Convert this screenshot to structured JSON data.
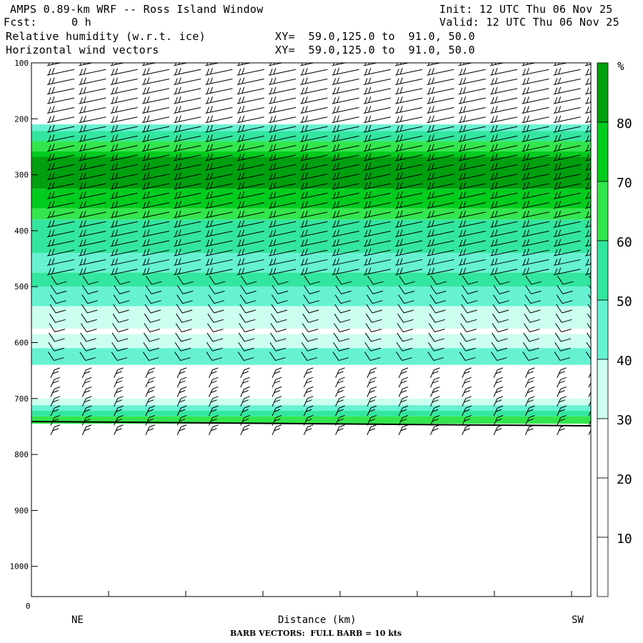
{
  "header": {
    "title": "AMPS 0.89-km WRF -- Ross Island Window",
    "init": "Init: 12 UTC Thu 06 Nov 25",
    "fcst_label": "Fcst:",
    "fcst_value": "0 h",
    "valid": "Valid: 12 UTC Thu 06 Nov 25",
    "field1": "Relative humidity (w.r.t. ice)",
    "field2": "Horizontal wind vectors",
    "xy1": "XY=  59.0,125.0 to  91.0, 50.0",
    "xy2": "XY=  59.0,125.0 to  91.0, 50.0"
  },
  "footer": {
    "x_axis_title": "Distance (km)",
    "left_end": "NE",
    "right_end": "SW",
    "origin_label": "0",
    "barb_note": "BARB VECTORS:  FULL BARB = 10 kts"
  },
  "chart_data": {
    "type": "heatmap",
    "title": "Relative humidity (w.r.t. ice)",
    "xlabel": "Distance (km)",
    "ylabel": "",
    "y_ticks": [
      "100",
      "200",
      "300",
      "400",
      "500",
      "600",
      "700",
      "800",
      "900",
      "1000"
    ],
    "ylim": [
      100,
      1050
    ],
    "y_axis": "pressure-like, increasing downward",
    "terrain_level": 745,
    "colorbar": {
      "unit": "%",
      "levels": [
        10,
        20,
        30,
        40,
        50,
        60,
        70,
        80
      ],
      "labels": [
        "10",
        "20",
        "30",
        "40",
        "50",
        "60",
        "70",
        "80"
      ],
      "colors": [
        "#ffffff",
        "#ffffff",
        "#ffffff",
        "#ccfff0",
        "#66f2d2",
        "#33e69f",
        "#33e64d",
        "#00cc1e",
        "#009f0f"
      ],
      "bins": [
        "0-10",
        "10-20",
        "20-30",
        "30-40",
        "40-50",
        "50-60",
        "60-70",
        "70-80",
        "80-100"
      ]
    },
    "rh_profile": [
      {
        "p_top": 100,
        "p_bottom": 210,
        "rh": 25
      },
      {
        "p_top": 210,
        "p_bottom": 222,
        "rh": 42
      },
      {
        "p_top": 222,
        "p_bottom": 240,
        "rh": 55
      },
      {
        "p_top": 240,
        "p_bottom": 258,
        "rh": 65
      },
      {
        "p_top": 258,
        "p_bottom": 268,
        "rh": 75
      },
      {
        "p_top": 268,
        "p_bottom": 325,
        "rh": 85
      },
      {
        "p_top": 325,
        "p_bottom": 360,
        "rh": 75
      },
      {
        "p_top": 360,
        "p_bottom": 380,
        "rh": 65
      },
      {
        "p_top": 380,
        "p_bottom": 440,
        "rh": 55
      },
      {
        "p_top": 440,
        "p_bottom": 475,
        "rh": 45
      },
      {
        "p_top": 475,
        "p_bottom": 500,
        "rh": 55
      },
      {
        "p_top": 500,
        "p_bottom": 535,
        "rh": 45
      },
      {
        "p_top": 535,
        "p_bottom": 575,
        "rh": 35
      },
      {
        "p_top": 575,
        "p_bottom": 585,
        "rh": 25
      },
      {
        "p_top": 585,
        "p_bottom": 610,
        "rh": 35
      },
      {
        "p_top": 610,
        "p_bottom": 640,
        "rh": 45
      },
      {
        "p_top": 640,
        "p_bottom": 700,
        "rh": 25
      },
      {
        "p_top": 700,
        "p_bottom": 712,
        "rh": 35
      },
      {
        "p_top": 712,
        "p_bottom": 722,
        "rh": 45
      },
      {
        "p_top": 722,
        "p_bottom": 732,
        "rh": 55
      },
      {
        "p_top": 732,
        "p_bottom": 745,
        "rh": 65
      }
    ],
    "barb_columns": 18
  }
}
